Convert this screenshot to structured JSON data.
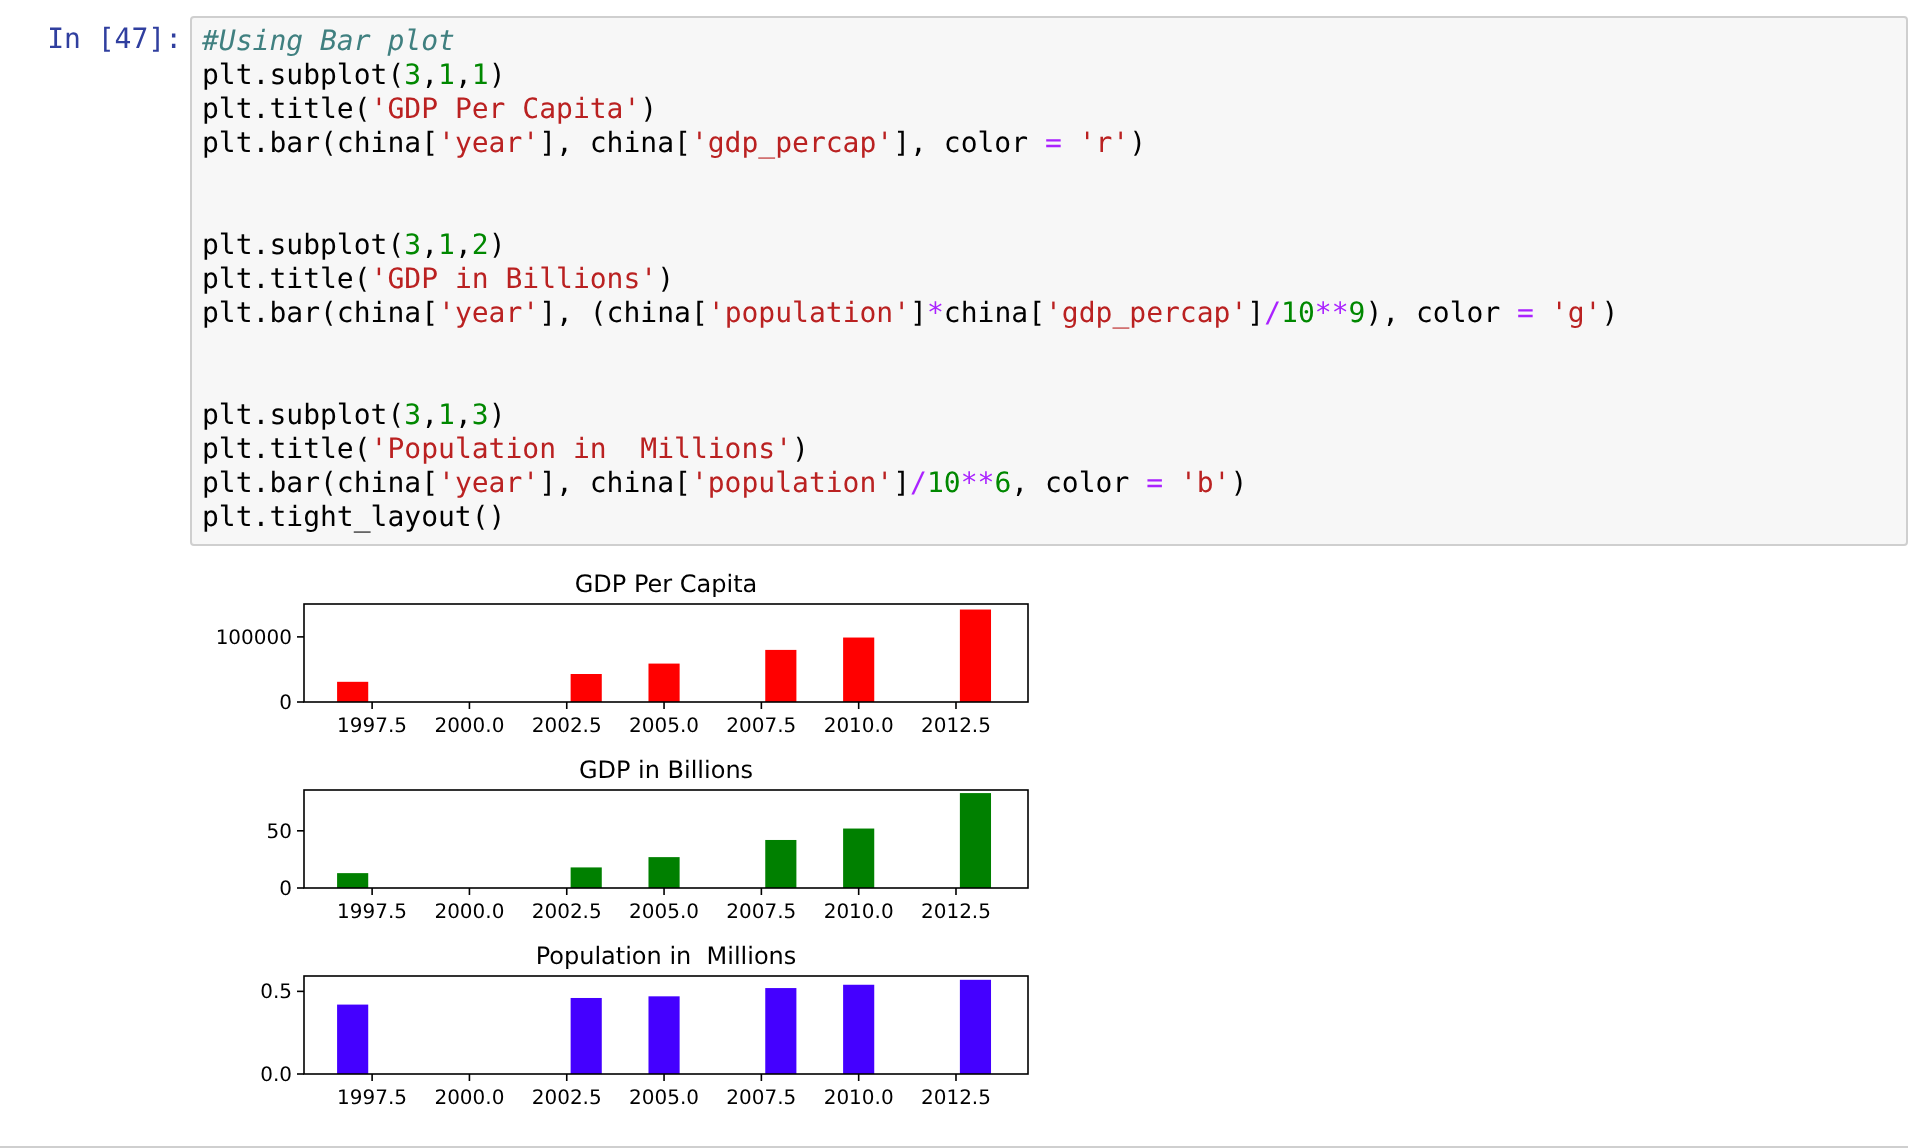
{
  "code_cell": {
    "prompt": "In [47]:",
    "blocks": [
      [
        [
          {
            "kind": "comment",
            "text": "#Using Bar plot"
          }
        ],
        [
          {
            "kind": "plain",
            "text": "plt.subplot("
          },
          {
            "kind": "number",
            "text": "3"
          },
          {
            "kind": "plain",
            "text": ","
          },
          {
            "kind": "number",
            "text": "1"
          },
          {
            "kind": "plain",
            "text": ","
          },
          {
            "kind": "number",
            "text": "1"
          },
          {
            "kind": "plain",
            "text": ")"
          }
        ],
        [
          {
            "kind": "plain",
            "text": "plt.title("
          },
          {
            "kind": "string",
            "text": "'GDP Per Capita'"
          },
          {
            "kind": "plain",
            "text": ")"
          }
        ],
        [
          {
            "kind": "plain",
            "text": "plt.bar(china["
          },
          {
            "kind": "string",
            "text": "'year'"
          },
          {
            "kind": "plain",
            "text": "], china["
          },
          {
            "kind": "string",
            "text": "'gdp_percap'"
          },
          {
            "kind": "plain",
            "text": "], color "
          },
          {
            "kind": "operator",
            "text": "= "
          },
          {
            "kind": "string",
            "text": "'r'"
          },
          {
            "kind": "plain",
            "text": ")"
          }
        ]
      ],
      [
        [
          {
            "kind": "plain",
            "text": "plt.subplot("
          },
          {
            "kind": "number",
            "text": "3"
          },
          {
            "kind": "plain",
            "text": ","
          },
          {
            "kind": "number",
            "text": "1"
          },
          {
            "kind": "plain",
            "text": ","
          },
          {
            "kind": "number",
            "text": "2"
          },
          {
            "kind": "plain",
            "text": ")"
          }
        ],
        [
          {
            "kind": "plain",
            "text": "plt.title("
          },
          {
            "kind": "string",
            "text": "'GDP in Billions'"
          },
          {
            "kind": "plain",
            "text": ")"
          }
        ],
        [
          {
            "kind": "plain",
            "text": "plt.bar(china["
          },
          {
            "kind": "string",
            "text": "'year'"
          },
          {
            "kind": "plain",
            "text": "], (china["
          },
          {
            "kind": "string",
            "text": "'population'"
          },
          {
            "kind": "plain",
            "text": "]"
          },
          {
            "kind": "operator",
            "text": "*"
          },
          {
            "kind": "plain",
            "text": "china["
          },
          {
            "kind": "string",
            "text": "'gdp_percap'"
          },
          {
            "kind": "plain",
            "text": "]"
          },
          {
            "kind": "operator",
            "text": "/"
          },
          {
            "kind": "number",
            "text": "10"
          },
          {
            "kind": "operator",
            "text": "**"
          },
          {
            "kind": "number",
            "text": "9"
          },
          {
            "kind": "plain",
            "text": "), color "
          },
          {
            "kind": "operator",
            "text": "= "
          },
          {
            "kind": "string",
            "text": "'g'"
          },
          {
            "kind": "plain",
            "text": ")"
          }
        ]
      ],
      [
        [
          {
            "kind": "plain",
            "text": "plt.subplot("
          },
          {
            "kind": "number",
            "text": "3"
          },
          {
            "kind": "plain",
            "text": ","
          },
          {
            "kind": "number",
            "text": "1"
          },
          {
            "kind": "plain",
            "text": ","
          },
          {
            "kind": "number",
            "text": "3"
          },
          {
            "kind": "plain",
            "text": ")"
          }
        ],
        [
          {
            "kind": "plain",
            "text": "plt.title("
          },
          {
            "kind": "string",
            "text": "'Population in  Millions'"
          },
          {
            "kind": "plain",
            "text": ")"
          }
        ],
        [
          {
            "kind": "plain",
            "text": "plt.bar(china["
          },
          {
            "kind": "string",
            "text": "'year'"
          },
          {
            "kind": "plain",
            "text": "], china["
          },
          {
            "kind": "string",
            "text": "'population'"
          },
          {
            "kind": "plain",
            "text": "]"
          },
          {
            "kind": "operator",
            "text": "/"
          },
          {
            "kind": "number",
            "text": "10"
          },
          {
            "kind": "operator",
            "text": "**"
          },
          {
            "kind": "number",
            "text": "6"
          },
          {
            "kind": "plain",
            "text": ", color "
          },
          {
            "kind": "operator",
            "text": "= "
          },
          {
            "kind": "string",
            "text": "'b'"
          },
          {
            "kind": "plain",
            "text": ")"
          }
        ],
        [
          {
            "kind": "plain",
            "text": "plt.tight_layout()"
          }
        ]
      ]
    ]
  },
  "output": {
    "charts": [
      {
        "chart_data": {
          "type": "bar",
          "title": "GDP Per Capita",
          "x": [
            1997,
            2003,
            2005,
            2008,
            2010,
            2013
          ],
          "series": [
            {
              "color": "#ff0000",
              "values": [
                31000,
                43000,
                59000,
                80000,
                99000,
                142000
              ]
            }
          ],
          "xlim": [
            1995.75,
            2014.35
          ],
          "ylim": [
            0,
            150500
          ],
          "xticks": [
            {
              "value": 1997.5,
              "label": "1997.5"
            },
            {
              "value": 2000,
              "label": "2000.0"
            },
            {
              "value": 2002.5,
              "label": "2002.5"
            },
            {
              "value": 2005,
              "label": "2005.0"
            },
            {
              "value": 2007.5,
              "label": "2007.5"
            },
            {
              "value": 2010,
              "label": "2010.0"
            },
            {
              "value": 2012.5,
              "label": "2012.5"
            }
          ],
          "yticks": [
            0,
            100000
          ]
        }
      },
      {
        "chart_data": {
          "type": "bar",
          "title": "GDP in Billions",
          "x": [
            1997,
            2003,
            2005,
            2008,
            2010,
            2013
          ],
          "series": [
            {
              "color": "#008000",
              "values": [
                13,
                18,
                27,
                42,
                52,
                83
              ]
            }
          ],
          "xlim": [
            1995.75,
            2014.35
          ],
          "ylim": [
            0,
            85.7
          ],
          "xticks": [
            {
              "value": 1997.5,
              "label": "1997.5"
            },
            {
              "value": 2000,
              "label": "2000.0"
            },
            {
              "value": 2002.5,
              "label": "2002.5"
            },
            {
              "value": 2005,
              "label": "2005.0"
            },
            {
              "value": 2007.5,
              "label": "2007.5"
            },
            {
              "value": 2010,
              "label": "2010.0"
            },
            {
              "value": 2012.5,
              "label": "2012.5"
            }
          ],
          "yticks": [
            0,
            50
          ]
        }
      },
      {
        "chart_data": {
          "type": "bar",
          "title": "Population in  Millions",
          "x": [
            1997,
            2003,
            2005,
            2008,
            2010,
            2013
          ],
          "series": [
            {
              "color": "#4400ff",
              "values": [
                0.42,
                0.46,
                0.47,
                0.52,
                0.54,
                0.57
              ]
            }
          ],
          "xlim": [
            1995.75,
            2014.35
          ],
          "ylim": [
            0,
            0.593
          ],
          "xticks": [
            {
              "value": 1997.5,
              "label": "1997.5"
            },
            {
              "value": 2000,
              "label": "2000.0"
            },
            {
              "value": 2002.5,
              "label": "2002.5"
            },
            {
              "value": 2005,
              "label": "2005.0"
            },
            {
              "value": 2007.5,
              "label": "2007.5"
            },
            {
              "value": 2010,
              "label": "2010.0"
            },
            {
              "value": 2012.5,
              "label": "2012.5"
            }
          ],
          "yticks": [
            {
              "value": 0,
              "label": "0.0"
            },
            {
              "value": 0.5,
              "label": "0.5"
            }
          ]
        }
      }
    ]
  }
}
